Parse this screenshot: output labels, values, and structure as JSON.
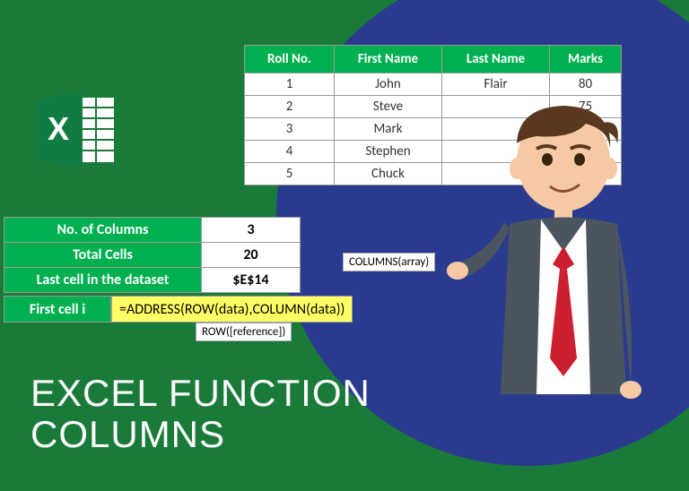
{
  "table": {
    "headers": [
      "Roll No.",
      "First Name",
      "Last Name",
      "Marks"
    ],
    "rows": [
      {
        "roll": "1",
        "first": "John",
        "last": "Flair",
        "marks": "80"
      },
      {
        "roll": "2",
        "first": "Steve",
        "last": "",
        "marks": "75"
      },
      {
        "roll": "3",
        "first": "Mark",
        "last": "",
        "marks": ""
      },
      {
        "roll": "4",
        "first": "Stephen",
        "last": "",
        "marks": ""
      },
      {
        "roll": "5",
        "first": "Chuck",
        "last": "",
        "marks": ""
      }
    ]
  },
  "info": {
    "cols_label": "No. of Columns",
    "cols_val": "3",
    "cells_label": "Total Cells",
    "cells_val": "20",
    "last_label": "Last cell in the dataset",
    "last_val": "$E$14",
    "first_label": "First cell i",
    "formula": "=ADDRESS(ROW(data),COLUMN(data))"
  },
  "tooltips": {
    "t1": "COLUMNS(array)",
    "t2": "ROW([reference])"
  },
  "title": {
    "l1": "EXCEL FUNCTION",
    "l2": "COLUMNS"
  }
}
